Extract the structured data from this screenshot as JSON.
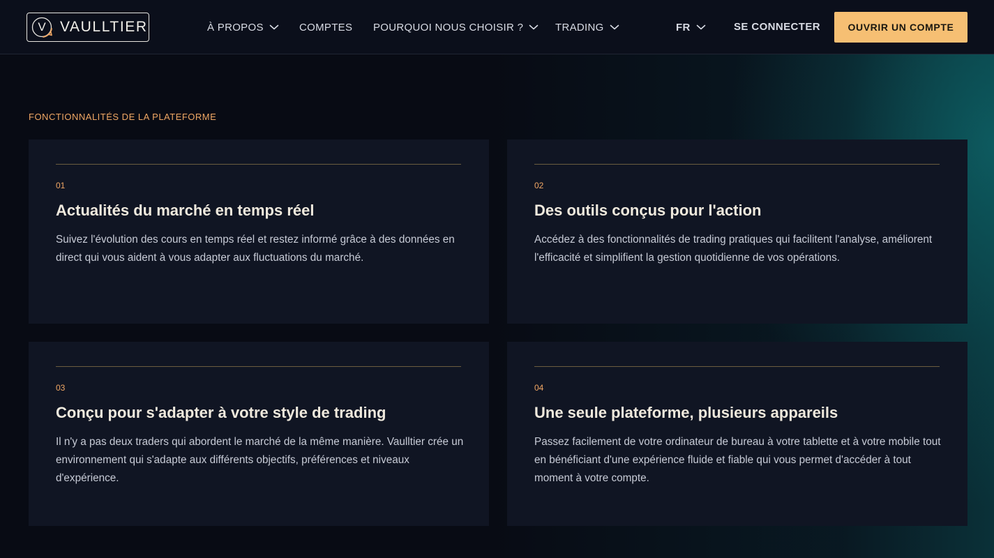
{
  "header": {
    "logo_letter": "V",
    "logo_text": "VAULLTIER",
    "nav": [
      {
        "label": "À PROPOS",
        "has_dropdown": true
      },
      {
        "label": "COMPTES",
        "has_dropdown": false
      },
      {
        "label": "POURQUOI NOUS CHOISIR ?",
        "has_dropdown": true
      },
      {
        "label": "TRADING",
        "has_dropdown": true
      }
    ],
    "language": "FR",
    "login_label": "SE CONNECTER",
    "open_account_label": "OUVRIR UN COMPTE"
  },
  "features": {
    "section_title": "FONCTIONNALITÉS DE LA PLATEFORME",
    "cards": [
      {
        "number": "01",
        "title": "Actualités du marché en temps réel",
        "text": "Suivez l'évolution des cours en temps réel et restez informé grâce à des données en direct qui vous aident à vous adapter aux fluctuations du marché."
      },
      {
        "number": "02",
        "title": "Des outils conçus pour l'action",
        "text": "Accédez à des fonctionnalités de trading pratiques qui facilitent l'analyse, améliorent l'efficacité et simplifient la gestion quotidienne de vos opérations."
      },
      {
        "number": "03",
        "title": "Conçu pour s'adapter à votre style de trading",
        "text": "Il n'y a pas deux traders qui abordent le marché de la même manière. Vaulltier crée un environnement qui s'adapte aux différents objectifs, préférences et niveaux d'expérience."
      },
      {
        "number": "04",
        "title": "Une seule plateforme, plusieurs appareils",
        "text": "Passez facilement de votre ordinateur de bureau à votre tablette et à votre mobile tout en bénéficiant d'une expérience fluide et fiable qui vous permet d'accéder à tout moment à votre compte."
      }
    ]
  },
  "colors": {
    "accent": "#f6bf73",
    "accent_text": "#f0a764",
    "background": "#080b14",
    "card": "#101523"
  },
  "icons": {
    "chevron": "chevron-down-icon",
    "logo": "logo-icon"
  }
}
